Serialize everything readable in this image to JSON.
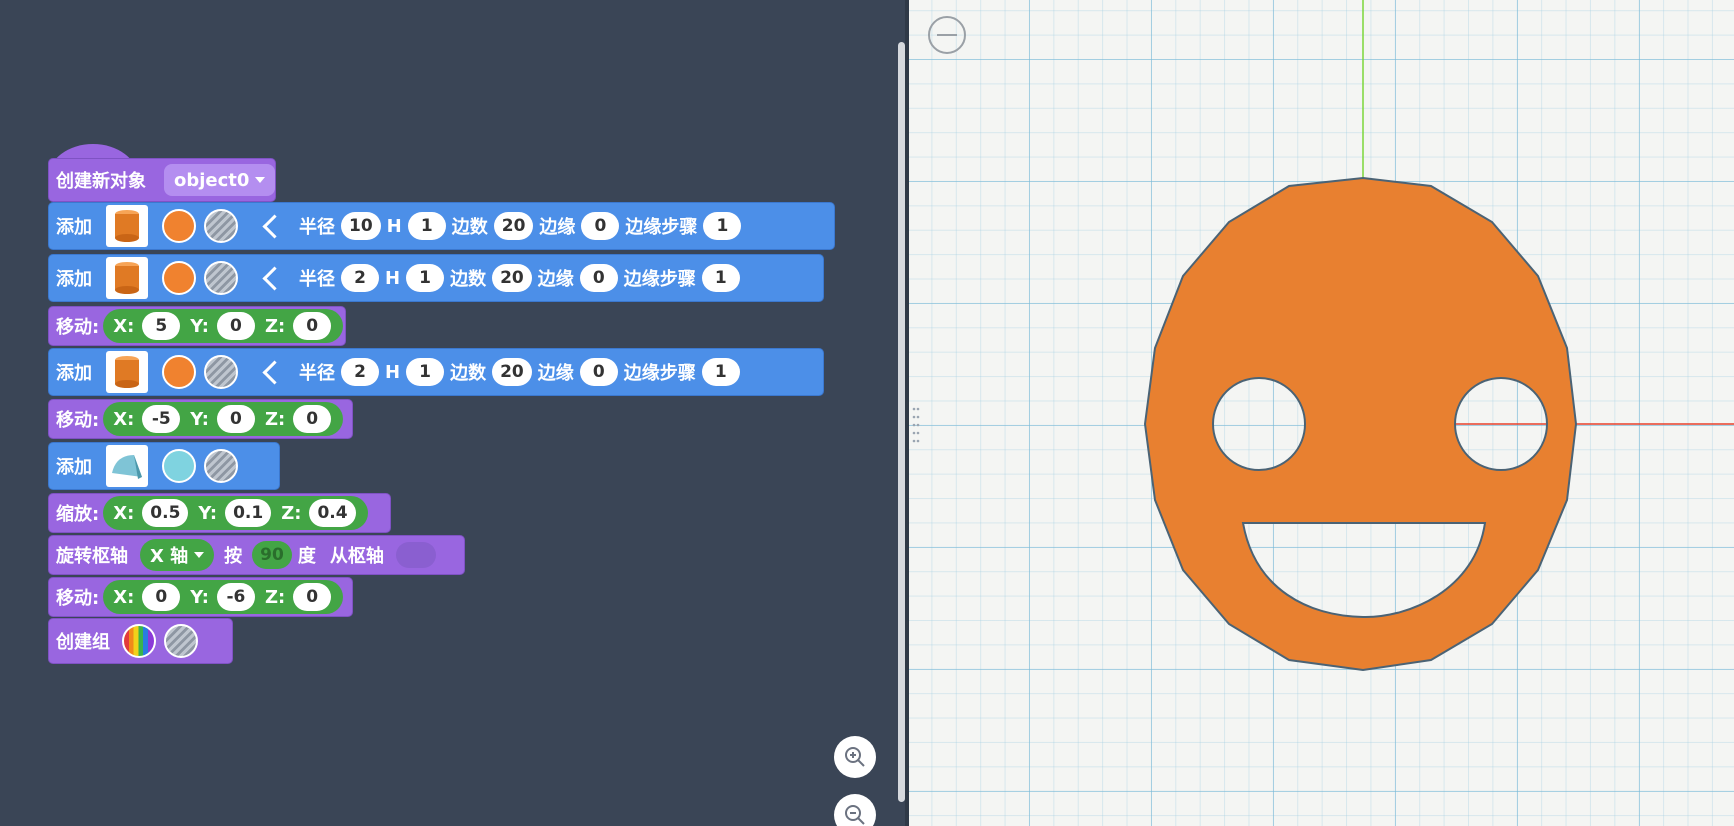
{
  "blocks": {
    "create_object": {
      "label": "创建新对象",
      "value": "object0"
    },
    "add1": {
      "label": "添加",
      "radius_label": "半径",
      "radius": "10",
      "h_label": "H",
      "h": "1",
      "sides_label": "边数",
      "sides": "20",
      "edge_label": "边缘",
      "edge": "0",
      "edge_steps_label": "边缘步骤",
      "edge_steps": "1"
    },
    "add2": {
      "label": "添加",
      "radius_label": "半径",
      "radius": "2",
      "h_label": "H",
      "h": "1",
      "sides_label": "边数",
      "sides": "20",
      "edge_label": "边缘",
      "edge": "0",
      "edge_steps_label": "边缘步骤",
      "edge_steps": "1"
    },
    "move1": {
      "label": "移动:",
      "x_label": "X:",
      "x": "5",
      "y_label": "Y:",
      "y": "0",
      "z_label": "Z:",
      "z": "0"
    },
    "add3": {
      "label": "添加",
      "radius_label": "半径",
      "radius": "2",
      "h_label": "H",
      "h": "1",
      "sides_label": "边数",
      "sides": "20",
      "edge_label": "边缘",
      "edge": "0",
      "edge_steps_label": "边缘步骤",
      "edge_steps": "1"
    },
    "move2": {
      "label": "移动:",
      "x_label": "X:",
      "x": "-5",
      "y_label": "Y:",
      "y": "0",
      "z_label": "Z:",
      "z": "0"
    },
    "add4": {
      "label": "添加"
    },
    "scale": {
      "label": "缩放:",
      "x_label": "X:",
      "x": "0.5",
      "y_label": "Y:",
      "y": "0.1",
      "z_label": "Z:",
      "z": "0.4"
    },
    "rotate": {
      "label": "旋转枢轴",
      "axis": "X 轴",
      "by_label": "按",
      "degrees": "90",
      "deg_label": "度",
      "from_pivot_label": "从枢轴"
    },
    "move3": {
      "label": "移动:",
      "x_label": "X:",
      "x": "0",
      "y_label": "Y:",
      "y": "-6",
      "z_label": "Z:",
      "z": "0"
    },
    "group": {
      "label": "创建组"
    }
  },
  "colors": {
    "workspace_bg": "#3a4556",
    "block_purple": "#9966e0",
    "block_blue": "#4c8fe8",
    "block_green": "#43a545",
    "orange": "#f0822f",
    "cyan": "#7fd3e0",
    "smiley": "#e88030"
  },
  "icons": {
    "cylinder": "cylinder-icon",
    "wedge": "wedge-icon",
    "zoom_in": "zoom-in-icon",
    "zoom_out": "zoom-out-icon",
    "minus": "minus-icon"
  }
}
